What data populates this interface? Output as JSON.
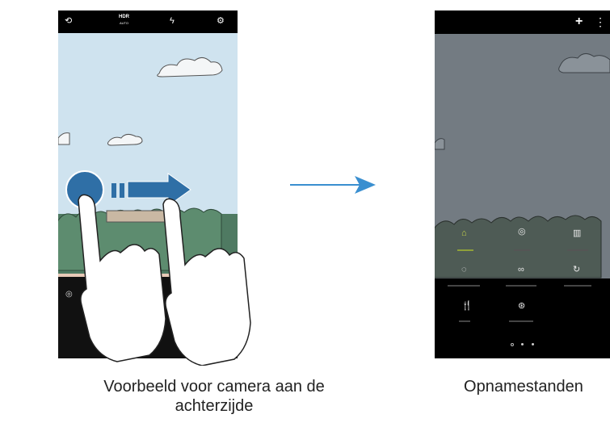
{
  "left_screen": {
    "hdr_label": "HDR",
    "hdr_sub": "AUTO"
  },
  "right_screen": {
    "plus_icon": "+",
    "more_icon": "⋮"
  },
  "captions": {
    "left_line1": "Voorbeeld voor camera aan de",
    "left_line2": "achterzijde",
    "right": "Opnamestanden"
  },
  "colors": {
    "swipe_accent": "#2f6fa6",
    "arrow": "#3a8fd0",
    "sky": "#cfe3ef",
    "dim_overlay": "#737b82"
  }
}
